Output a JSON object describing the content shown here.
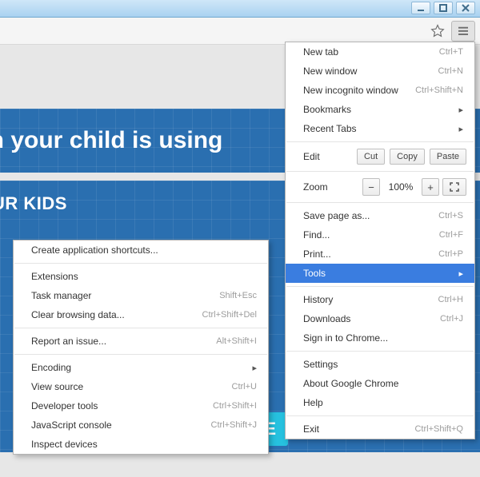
{
  "page": {
    "banner_headline": "en your child is using",
    "section_heading": "UR KIDS",
    "cta": "AD FREE"
  },
  "main_menu": {
    "new_tab": {
      "label": "New tab",
      "shortcut": "Ctrl+T"
    },
    "new_window": {
      "label": "New window",
      "shortcut": "Ctrl+N"
    },
    "incognito": {
      "label": "New incognito window",
      "shortcut": "Ctrl+Shift+N"
    },
    "bookmarks": {
      "label": "Bookmarks"
    },
    "recent_tabs": {
      "label": "Recent Tabs"
    },
    "edit": {
      "label": "Edit",
      "cut": "Cut",
      "copy": "Copy",
      "paste": "Paste"
    },
    "zoom": {
      "label": "Zoom",
      "value": "100%"
    },
    "save_as": {
      "label": "Save page as...",
      "shortcut": "Ctrl+S"
    },
    "find": {
      "label": "Find...",
      "shortcut": "Ctrl+F"
    },
    "print": {
      "label": "Print...",
      "shortcut": "Ctrl+P"
    },
    "tools": {
      "label": "Tools"
    },
    "history": {
      "label": "History",
      "shortcut": "Ctrl+H"
    },
    "downloads": {
      "label": "Downloads",
      "shortcut": "Ctrl+J"
    },
    "signin": {
      "label": "Sign in to Chrome..."
    },
    "settings": {
      "label": "Settings"
    },
    "about": {
      "label": "About Google Chrome"
    },
    "help": {
      "label": "Help"
    },
    "exit": {
      "label": "Exit",
      "shortcut": "Ctrl+Shift+Q"
    }
  },
  "tools_menu": {
    "create_shortcuts": {
      "label": "Create application shortcuts..."
    },
    "extensions": {
      "label": "Extensions"
    },
    "task_manager": {
      "label": "Task manager",
      "shortcut": "Shift+Esc"
    },
    "clear_data": {
      "label": "Clear browsing data...",
      "shortcut": "Ctrl+Shift+Del"
    },
    "report_issue": {
      "label": "Report an issue...",
      "shortcut": "Alt+Shift+I"
    },
    "encoding": {
      "label": "Encoding"
    },
    "view_source": {
      "label": "View source",
      "shortcut": "Ctrl+U"
    },
    "dev_tools": {
      "label": "Developer tools",
      "shortcut": "Ctrl+Shift+I"
    },
    "js_console": {
      "label": "JavaScript console",
      "shortcut": "Ctrl+Shift+J"
    },
    "inspect_devices": {
      "label": "Inspect devices"
    }
  }
}
